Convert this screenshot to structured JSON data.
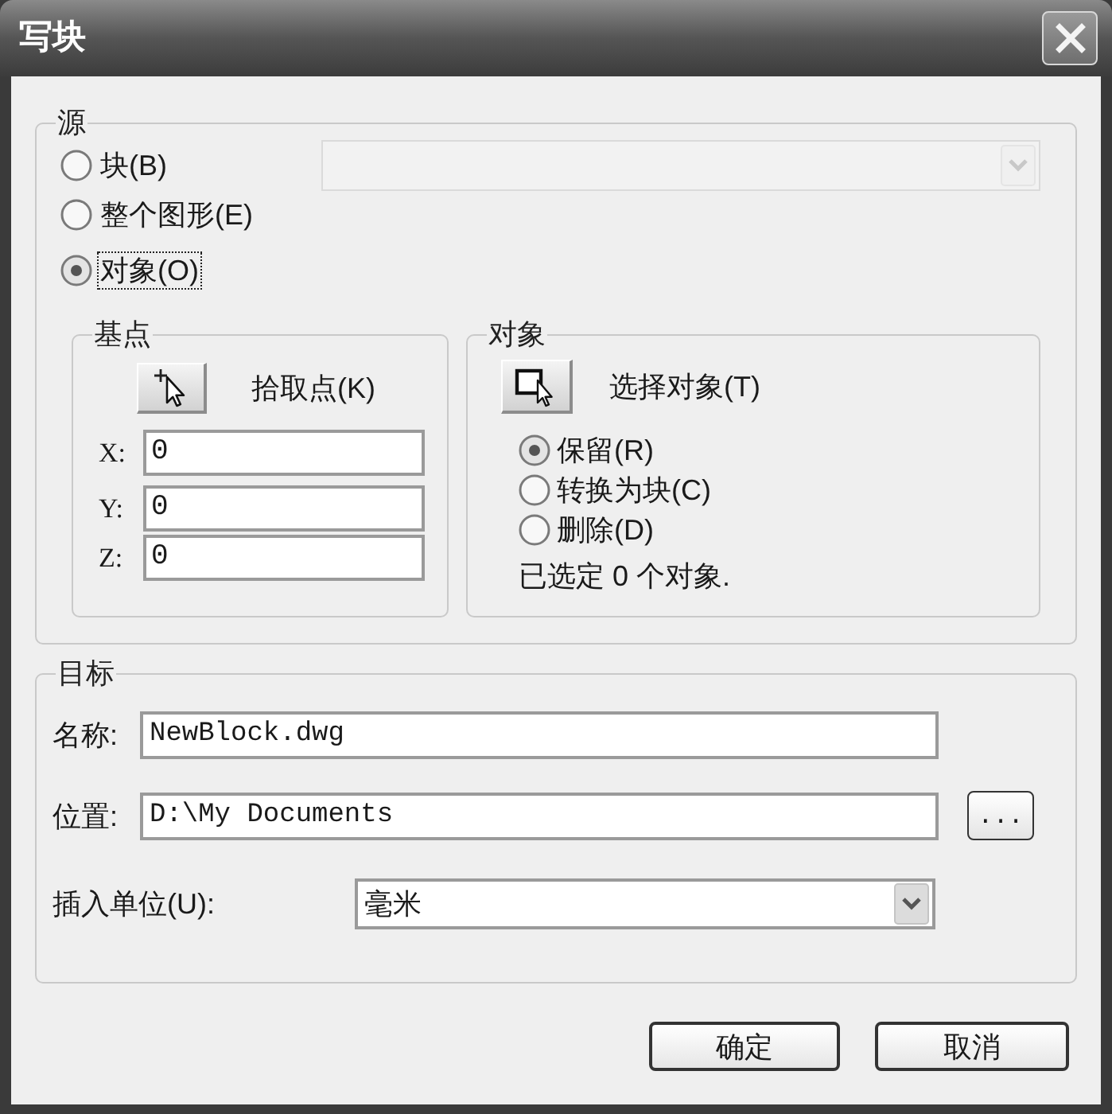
{
  "window": {
    "title": "写块"
  },
  "source": {
    "label": "源",
    "options": [
      {
        "label": "块(B)",
        "selected": false,
        "focused": false
      },
      {
        "label": "整个图形(E)",
        "selected": false,
        "focused": false
      },
      {
        "label": "对象(O)",
        "selected": true,
        "focused": true
      }
    ],
    "block_dropdown": {
      "disabled": true
    }
  },
  "base_point": {
    "label": "基点",
    "pick_button_label": "拾取点(K)",
    "coordinates": [
      {
        "label": "X:",
        "value": "0"
      },
      {
        "label": "Y:",
        "value": "0"
      },
      {
        "label": "Z:",
        "value": "0"
      }
    ]
  },
  "objects": {
    "label": "对象",
    "select_button_label": "选择对象(T)",
    "options": [
      {
        "label": "保留(R)",
        "selected": true
      },
      {
        "label": "转换为块(C)",
        "selected": false
      },
      {
        "label": "删除(D)",
        "selected": false
      }
    ],
    "status": "已选定 0 个对象."
  },
  "destination": {
    "label": "目标",
    "fields": [
      {
        "kind": "text",
        "label": "名称:",
        "value": "NewBlock.dwg"
      },
      {
        "kind": "browse",
        "label": "位置:",
        "value": "D:\\My Documents",
        "button": "..."
      },
      {
        "kind": "dropdown",
        "label": "插入单位(U):",
        "value": "毫米"
      }
    ]
  },
  "buttons": [
    "确定",
    "取消"
  ]
}
